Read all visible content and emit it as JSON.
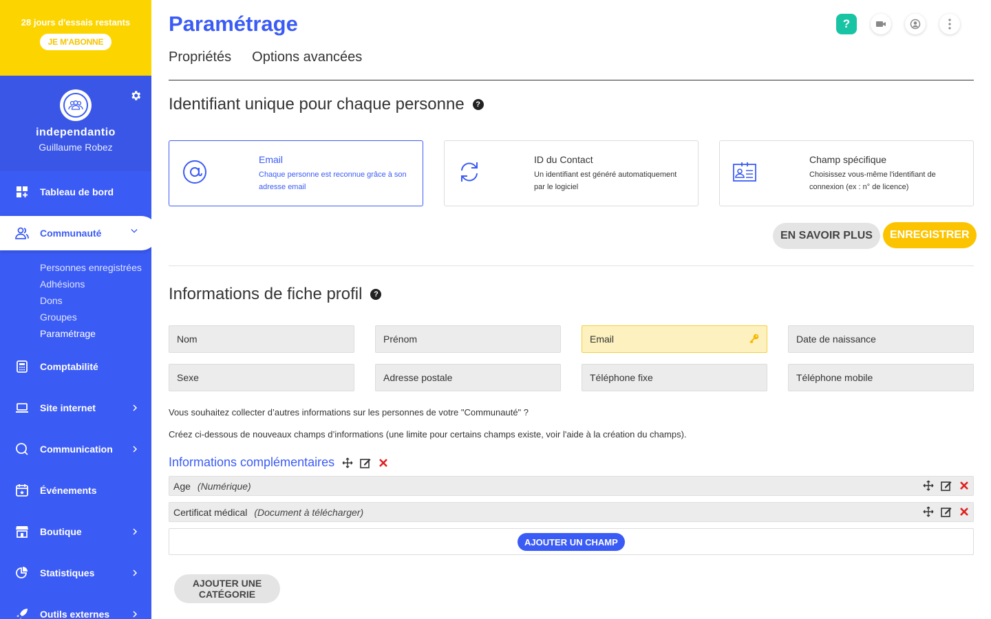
{
  "trial": {
    "text": "28 jours d'essais restants",
    "button": "JE M'ABONNE"
  },
  "profile": {
    "org": "independantio",
    "user": "Guillaume Robez"
  },
  "nav": {
    "dashboard": "Tableau de bord",
    "community": "Communauté",
    "community_sub": [
      "Personnes enregistrées",
      "Adhésions",
      "Dons",
      "Groupes",
      "Paramétrage"
    ],
    "accounting": "Comptabilité",
    "website": "Site internet",
    "communication": "Communication",
    "events": "Événements",
    "shop": "Boutique",
    "stats": "Statistiques",
    "tools": "Outils externes"
  },
  "page": {
    "title": "Paramétrage",
    "tabs": [
      "Propriétés",
      "Options avancées"
    ]
  },
  "identifier": {
    "title": "Identifiant unique pour chaque personne",
    "cards": [
      {
        "title": "Email",
        "desc": "Chaque personne est reconnue grâce à son adresse email",
        "icon": "at-icon"
      },
      {
        "title": "ID du Contact",
        "desc": "Un identifiant est généré automatiquement par le logiciel",
        "icon": "refresh-icon"
      },
      {
        "title": "Champ spécifique",
        "desc": "Choisissez vous-même l'identifiant de connexion (ex : n° de licence)",
        "icon": "id-card-icon"
      }
    ],
    "btn_more": "EN SAVOIR PLUS",
    "btn_save": "ENREGISTRER"
  },
  "profile_info": {
    "title": "Informations de fiche profil",
    "fields": [
      "Nom",
      "Prénom",
      "Email",
      "Date de naissance",
      "Sexe",
      "Adresse postale",
      "Téléphone fixe",
      "Téléphone mobile"
    ],
    "question": "Vous souhaitez collecter d’autres informations sur les personnes de votre \"Communauté\" ?",
    "instruction": "Créez ci-dessous de nouveaux champs d’informations (une limite pour certains champs existe, voir l'aide à la création du champs)."
  },
  "extra": {
    "title": "Informations complémentaires",
    "rows": [
      {
        "name": "Age",
        "type": "(Numérique)"
      },
      {
        "name": "Certificat médical",
        "type": "(Document à télécharger)"
      }
    ],
    "add_field": "AJOUTER UN CHAMP",
    "add_category_line1": "AJOUTER UNE",
    "add_category_line2": "CATÉGORIE"
  },
  "colors": {
    "primary": "#3b5bf5",
    "yellow": "#fcd500",
    "teal": "#19c4a4",
    "delete": "#e02020"
  }
}
